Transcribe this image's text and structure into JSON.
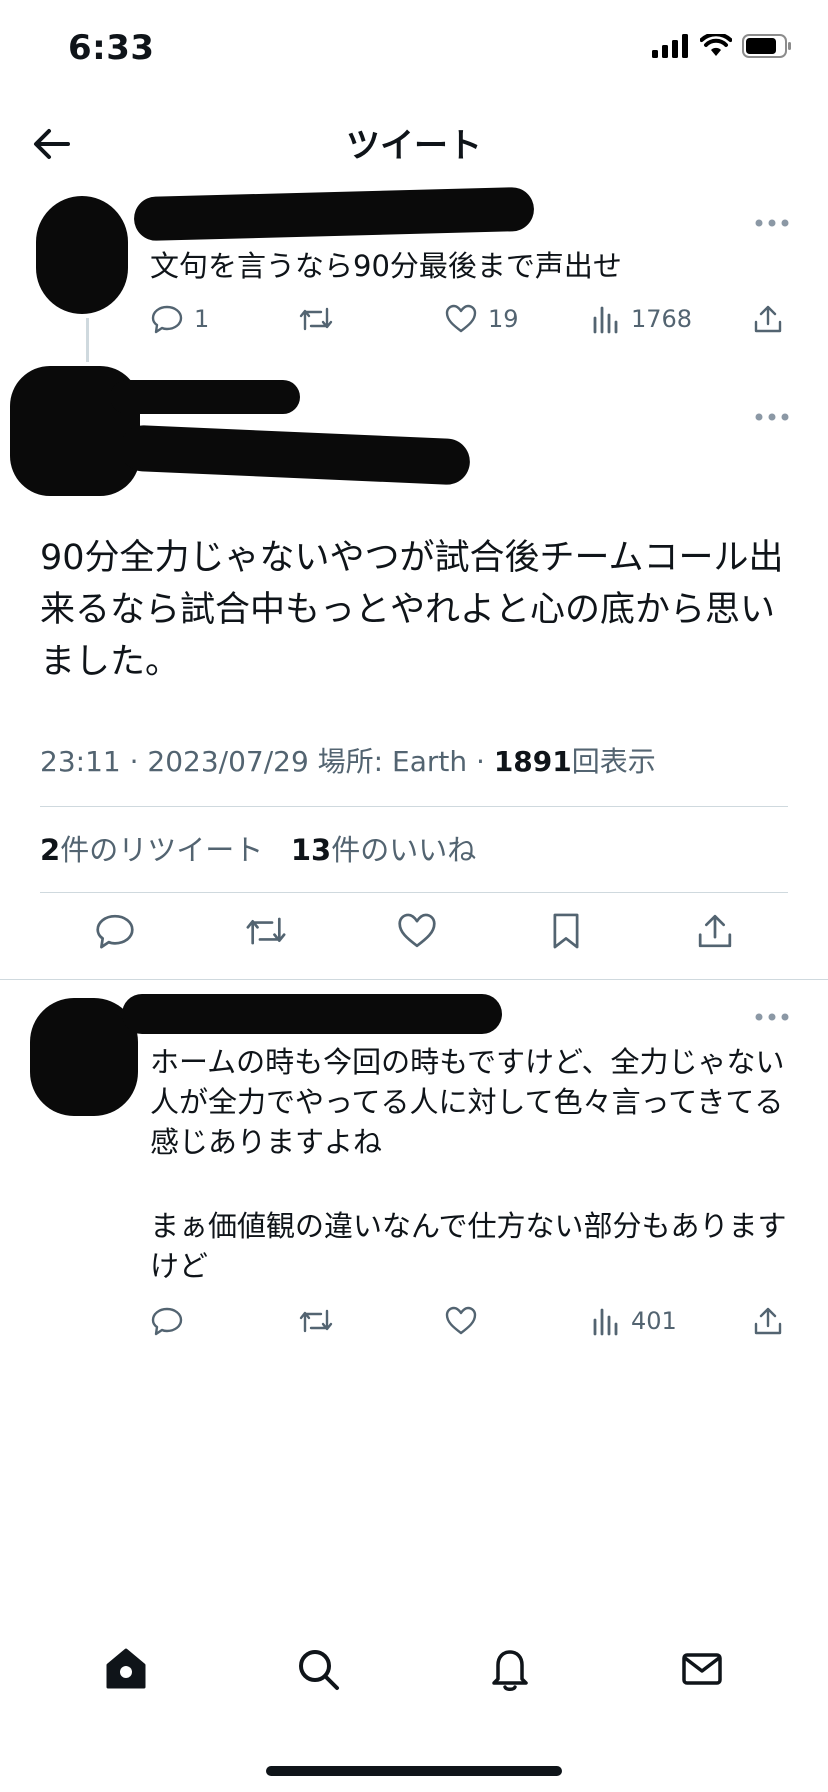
{
  "status_bar": {
    "time": "6:33"
  },
  "nav": {
    "title": "ツイート"
  },
  "parent_tweet": {
    "text": "文句を言うなら90分最後まで声出せ",
    "replies": "1",
    "retweets": "",
    "likes": "19",
    "views": "1768"
  },
  "main_tweet": {
    "text": "90分全力じゃないやつが試合後チームコール出来るなら試合中もっとやれよと心の底から思いました。",
    "time_date": "23:11 · 2023/07/29",
    "location": " 場所: Earth · ",
    "view_count": "1891",
    "view_label": "回表示",
    "retweet_count": "2",
    "retweet_label": "件のリツイート",
    "like_count": "13",
    "like_label": "件のいいね"
  },
  "reply_tweet": {
    "text_line1": "ホームの時も今回の時もですけど、全力じゃない人が全力でやってる人に対して色々言ってきてる感じありますよね",
    "text_line2": "まぁ価値観の違いなんで仕方ない部分もありますけど",
    "views": "401"
  },
  "colors": {
    "text": "#0f1419",
    "secondary": "#536471",
    "divider": "#cfd9de"
  },
  "icons": [
    "back-arrow-icon",
    "reply-icon",
    "retweet-icon",
    "like-icon",
    "views-icon",
    "share-icon",
    "bookmark-icon",
    "more-icon",
    "home-icon",
    "search-icon",
    "bell-icon",
    "mail-icon",
    "signal-icon",
    "wifi-icon",
    "battery-icon"
  ]
}
